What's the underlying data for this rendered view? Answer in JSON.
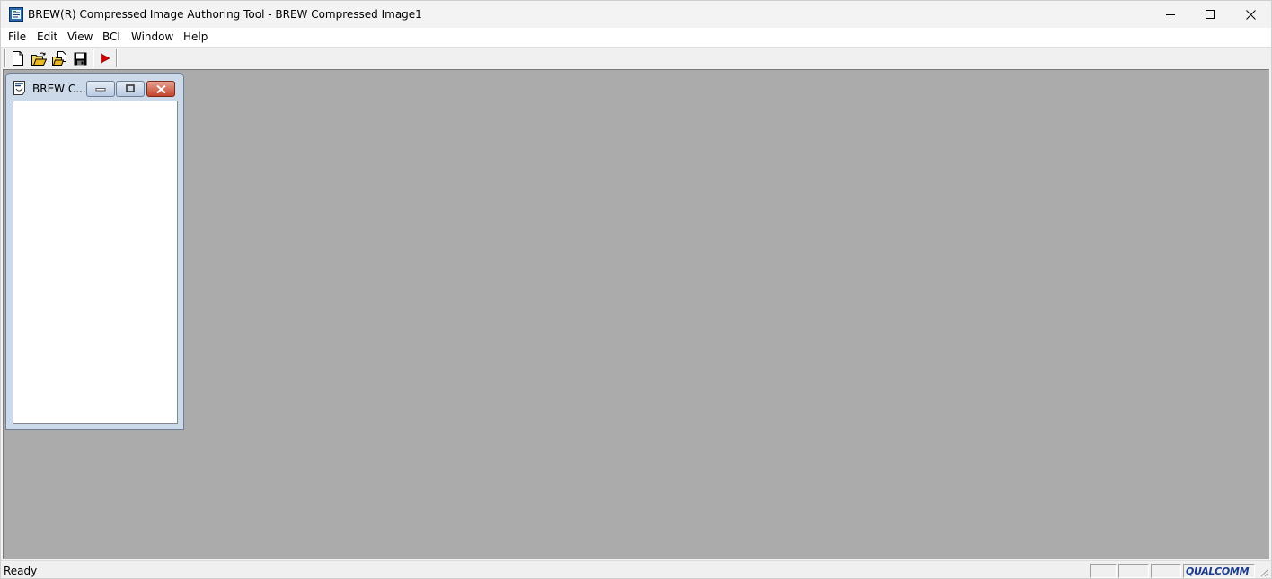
{
  "window": {
    "title": "BREW(R) Compressed Image Authoring Tool - BREW Compressed Image1"
  },
  "menu": [
    {
      "label": "File"
    },
    {
      "label": "Edit"
    },
    {
      "label": "View"
    },
    {
      "label": "BCI"
    },
    {
      "label": "Window"
    },
    {
      "label": "Help"
    }
  ],
  "toolbar": {
    "buttons": [
      {
        "icon": "new-document-icon"
      },
      {
        "icon": "open-folder-icon"
      },
      {
        "icon": "open-recent-icon"
      },
      {
        "icon": "save-disk-icon"
      },
      {
        "icon": "play-icon",
        "color": "#d40000"
      }
    ]
  },
  "child_window": {
    "title": "BREW C..."
  },
  "status": {
    "text": "Ready",
    "logo_text": "QUALCOMM"
  },
  "colors": {
    "mdi_background": "#ababab",
    "child_frame": "#cbd9e9",
    "close_button": "#c3432c",
    "logo": "#1b3a8c"
  }
}
